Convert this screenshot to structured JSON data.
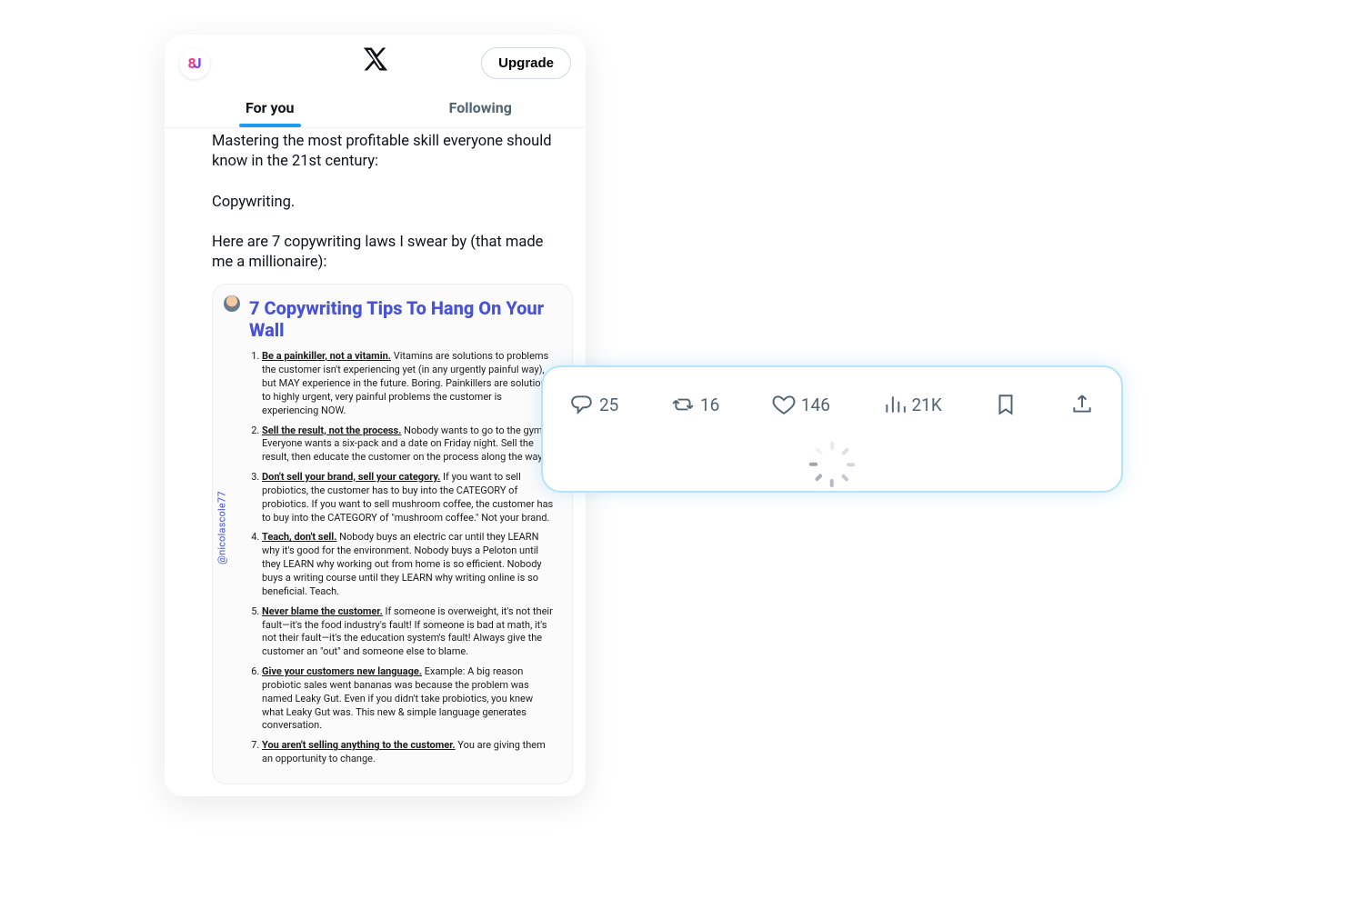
{
  "header": {
    "upgrade_label": "Upgrade"
  },
  "tabs": {
    "for_you": "For you",
    "following": "Following"
  },
  "tweet": {
    "line1": "Mastering the most profitable skill everyone should know in the 21st century:",
    "line2": "Copywriting.",
    "line3": "Here are 7 copywriting laws I swear by (that made me a millionaire):"
  },
  "card": {
    "title": "7 Copywriting Tips To Hang On Your Wall",
    "handle": "@nicolascole77",
    "tips": [
      {
        "b": "Be a painkiller, not a vitamin.",
        "t": " Vitamins are solutions to problems the customer isn't experiencing yet (in any urgently painful way), but MAY experience in the future. Boring. Painkillers are solutions to highly urgent, very painful problems the customer is experiencing NOW."
      },
      {
        "b": "Sell the result, not the process.",
        "t": " Nobody wants to go to the gym. Everyone wants a six-pack and a date on Friday night. Sell the result, then educate the customer on the process along the way."
      },
      {
        "b": "Don't sell your brand, sell your category.",
        "t": " If you want to sell probiotics, the customer has to buy into the CATEGORY of probiotics. If you want to sell mushroom coffee, the customer has to buy into the CATEGORY of \"mushroom coffee.\" Not your brand."
      },
      {
        "b": "Teach, don't sell.",
        "t": " Nobody buys an electric car until they LEARN why it's good for the environment. Nobody buys a Peloton until they LEARN why working out from home is so efficient. Nobody buys a writing course until they LEARN why writing online is so beneficial. Teach."
      },
      {
        "b": "Never blame the customer.",
        "t": " If someone is overweight, it's not their fault—it's the food industry's fault! If someone is bad at math, it's not their fault—it's the education system's fault! Always give the customer an \"out\" and someone else to blame."
      },
      {
        "b": "Give your customers new language.",
        "t": " Example: A big reason probiotic sales went bananas was because the problem was named Leaky Gut. Even if you didn't take probiotics, you knew what Leaky Gut was. This new & simple language generates conversation."
      },
      {
        "b": "You aren't selling anything to the customer.",
        "t": " You are giving them an opportunity to change."
      }
    ]
  },
  "metrics": {
    "replies": "25",
    "retweets": "16",
    "likes": "146",
    "views": "21K"
  }
}
